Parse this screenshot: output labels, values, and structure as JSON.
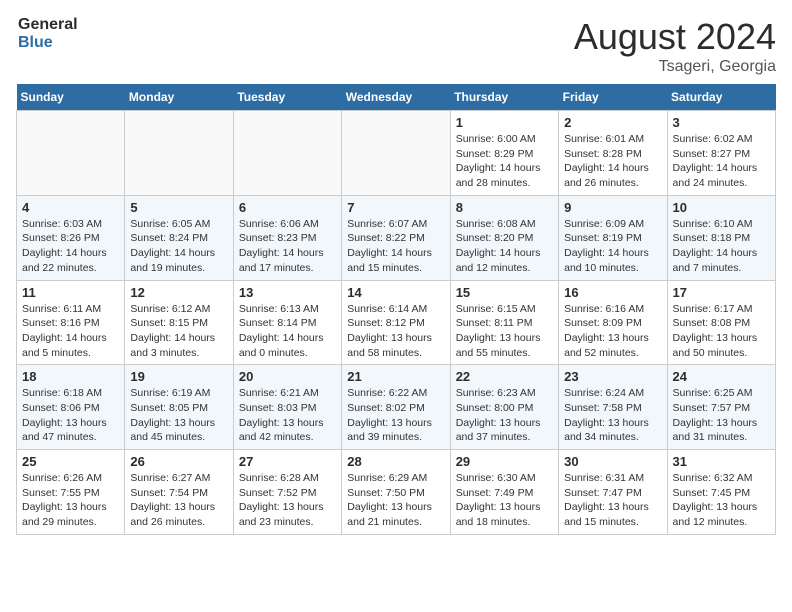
{
  "header": {
    "logo_text_general": "General",
    "logo_text_blue": "Blue",
    "month_year": "August 2024",
    "location": "Tsageri, Georgia"
  },
  "weekdays": [
    "Sunday",
    "Monday",
    "Tuesday",
    "Wednesday",
    "Thursday",
    "Friday",
    "Saturday"
  ],
  "weeks": [
    [
      {
        "day": "",
        "info": ""
      },
      {
        "day": "",
        "info": ""
      },
      {
        "day": "",
        "info": ""
      },
      {
        "day": "",
        "info": ""
      },
      {
        "day": "1",
        "info": "Sunrise: 6:00 AM\nSunset: 8:29 PM\nDaylight: 14 hours\nand 28 minutes."
      },
      {
        "day": "2",
        "info": "Sunrise: 6:01 AM\nSunset: 8:28 PM\nDaylight: 14 hours\nand 26 minutes."
      },
      {
        "day": "3",
        "info": "Sunrise: 6:02 AM\nSunset: 8:27 PM\nDaylight: 14 hours\nand 24 minutes."
      }
    ],
    [
      {
        "day": "4",
        "info": "Sunrise: 6:03 AM\nSunset: 8:26 PM\nDaylight: 14 hours\nand 22 minutes."
      },
      {
        "day": "5",
        "info": "Sunrise: 6:05 AM\nSunset: 8:24 PM\nDaylight: 14 hours\nand 19 minutes."
      },
      {
        "day": "6",
        "info": "Sunrise: 6:06 AM\nSunset: 8:23 PM\nDaylight: 14 hours\nand 17 minutes."
      },
      {
        "day": "7",
        "info": "Sunrise: 6:07 AM\nSunset: 8:22 PM\nDaylight: 14 hours\nand 15 minutes."
      },
      {
        "day": "8",
        "info": "Sunrise: 6:08 AM\nSunset: 8:20 PM\nDaylight: 14 hours\nand 12 minutes."
      },
      {
        "day": "9",
        "info": "Sunrise: 6:09 AM\nSunset: 8:19 PM\nDaylight: 14 hours\nand 10 minutes."
      },
      {
        "day": "10",
        "info": "Sunrise: 6:10 AM\nSunset: 8:18 PM\nDaylight: 14 hours\nand 7 minutes."
      }
    ],
    [
      {
        "day": "11",
        "info": "Sunrise: 6:11 AM\nSunset: 8:16 PM\nDaylight: 14 hours\nand 5 minutes."
      },
      {
        "day": "12",
        "info": "Sunrise: 6:12 AM\nSunset: 8:15 PM\nDaylight: 14 hours\nand 3 minutes."
      },
      {
        "day": "13",
        "info": "Sunrise: 6:13 AM\nSunset: 8:14 PM\nDaylight: 14 hours\nand 0 minutes."
      },
      {
        "day": "14",
        "info": "Sunrise: 6:14 AM\nSunset: 8:12 PM\nDaylight: 13 hours\nand 58 minutes."
      },
      {
        "day": "15",
        "info": "Sunrise: 6:15 AM\nSunset: 8:11 PM\nDaylight: 13 hours\nand 55 minutes."
      },
      {
        "day": "16",
        "info": "Sunrise: 6:16 AM\nSunset: 8:09 PM\nDaylight: 13 hours\nand 52 minutes."
      },
      {
        "day": "17",
        "info": "Sunrise: 6:17 AM\nSunset: 8:08 PM\nDaylight: 13 hours\nand 50 minutes."
      }
    ],
    [
      {
        "day": "18",
        "info": "Sunrise: 6:18 AM\nSunset: 8:06 PM\nDaylight: 13 hours\nand 47 minutes."
      },
      {
        "day": "19",
        "info": "Sunrise: 6:19 AM\nSunset: 8:05 PM\nDaylight: 13 hours\nand 45 minutes."
      },
      {
        "day": "20",
        "info": "Sunrise: 6:21 AM\nSunset: 8:03 PM\nDaylight: 13 hours\nand 42 minutes."
      },
      {
        "day": "21",
        "info": "Sunrise: 6:22 AM\nSunset: 8:02 PM\nDaylight: 13 hours\nand 39 minutes."
      },
      {
        "day": "22",
        "info": "Sunrise: 6:23 AM\nSunset: 8:00 PM\nDaylight: 13 hours\nand 37 minutes."
      },
      {
        "day": "23",
        "info": "Sunrise: 6:24 AM\nSunset: 7:58 PM\nDaylight: 13 hours\nand 34 minutes."
      },
      {
        "day": "24",
        "info": "Sunrise: 6:25 AM\nSunset: 7:57 PM\nDaylight: 13 hours\nand 31 minutes."
      }
    ],
    [
      {
        "day": "25",
        "info": "Sunrise: 6:26 AM\nSunset: 7:55 PM\nDaylight: 13 hours\nand 29 minutes."
      },
      {
        "day": "26",
        "info": "Sunrise: 6:27 AM\nSunset: 7:54 PM\nDaylight: 13 hours\nand 26 minutes."
      },
      {
        "day": "27",
        "info": "Sunrise: 6:28 AM\nSunset: 7:52 PM\nDaylight: 13 hours\nand 23 minutes."
      },
      {
        "day": "28",
        "info": "Sunrise: 6:29 AM\nSunset: 7:50 PM\nDaylight: 13 hours\nand 21 minutes."
      },
      {
        "day": "29",
        "info": "Sunrise: 6:30 AM\nSunset: 7:49 PM\nDaylight: 13 hours\nand 18 minutes."
      },
      {
        "day": "30",
        "info": "Sunrise: 6:31 AM\nSunset: 7:47 PM\nDaylight: 13 hours\nand 15 minutes."
      },
      {
        "day": "31",
        "info": "Sunrise: 6:32 AM\nSunset: 7:45 PM\nDaylight: 13 hours\nand 12 minutes."
      }
    ]
  ]
}
